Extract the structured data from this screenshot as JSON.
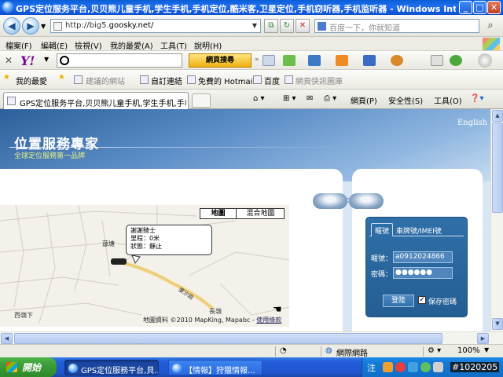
{
  "window": {
    "title": "GPS定位服务平台,贝贝熊儿童手机,学生手机,手机定位,酷米客,卫星定位,手机窃听器,手机监听器 - Windows Internet Explo...",
    "min_label": "_",
    "max_label": "□",
    "close_label": "✕"
  },
  "addressbar": {
    "url_prefix": "http://big5.",
    "url_host": "goosky.net/",
    "search_placeholder": "百度一下，你就知道"
  },
  "menu": [
    "檔案(F)",
    "編輯(E)",
    "檢視(V)",
    "我的最愛(A)",
    "工具(T)",
    "說明(H)"
  ],
  "yahoo_toolbar": {
    "logo": "Y!",
    "web_search_label": "網頁搜尋"
  },
  "favorites": {
    "label": "我的最愛",
    "items": [
      "建議的網站",
      "自訂連結",
      "免費的 Hotmail",
      "百度",
      "網頁快訊圖庫"
    ]
  },
  "tab": {
    "title": "GPS定位服务平台,贝贝熊儿童手机,学生手机,手机..."
  },
  "tab_commands": [
    "網頁(P)",
    "安全性(S)",
    "工具(O)"
  ],
  "page": {
    "brand": "位置服務專家",
    "tagline": "全球定位服務第一品牌",
    "english_link": "English",
    "map": {
      "tab_active": "地圖",
      "tab_other": "混合地圖",
      "info_lines": [
        "謝謝騎士",
        "里程：0米",
        "狀態：靜止",
        "..."
      ],
      "places": [
        "蓮塘",
        "西嶺下",
        "長嶺",
        "廈沙路"
      ],
      "copyright": "地圖資料 ©2010 MapKing, Mapabc - ",
      "terms_link": "使用條款"
    },
    "login": {
      "tab_active": "暱號",
      "tab_other": "車牌號/IMEI號",
      "account_label": "暱號：",
      "account_value": "a0912024866",
      "password_label": "密碼：",
      "password_value": "●●●●●●",
      "login_button": "登陸",
      "remember_label": "保存密碼",
      "remember_checked": true
    }
  },
  "statusbar": {
    "zone": "網際網路",
    "zoom": "100%"
  },
  "taskbar": {
    "start_label": "開始",
    "items": [
      "GPS定位服務平台,貝...",
      "【情報】狩獵情報..."
    ],
    "ime": "注",
    "clock": "#1020205"
  }
}
